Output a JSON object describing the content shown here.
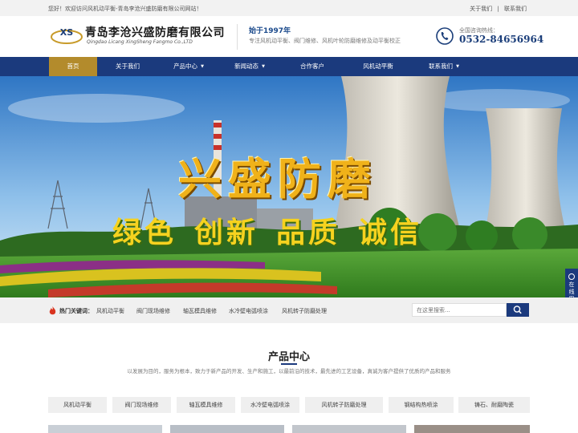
{
  "topbar": {
    "welcome": "您好！欢迎访问风机动平衡-青岛李沧兴盛防磨有限公司网站！",
    "link_about": "关于我们",
    "separator": "|",
    "link_contact": "联系我们"
  },
  "header": {
    "logo_mark": "XS",
    "logo_cn": "青岛李沧兴盛防磨有限公司",
    "logo_en": "Qingdao Licang XingSheng Fangmo Co.,LTD",
    "since": "始于1997年",
    "slogan": "专注风机动平衡、阀门维修、风机叶轮防磨维修及动平衡校正",
    "hotline_label": "全国咨询热线：",
    "hotline_number": "0532-84656964"
  },
  "nav": {
    "items": [
      {
        "label": "首页",
        "active": true,
        "dropdown": false
      },
      {
        "label": "关于我们",
        "active": false,
        "dropdown": false
      },
      {
        "label": "产品中心",
        "active": false,
        "dropdown": true
      },
      {
        "label": "新闻动态",
        "active": false,
        "dropdown": true
      },
      {
        "label": "合作客户",
        "active": false,
        "dropdown": false
      },
      {
        "label": "风机动平衡",
        "active": false,
        "dropdown": false
      },
      {
        "label": "联系我们",
        "active": false,
        "dropdown": true
      }
    ]
  },
  "banner": {
    "title": "兴盛防磨",
    "values": [
      "绿色",
      "创新",
      "品质",
      "诚信"
    ],
    "service_tab": [
      "在",
      "线",
      "客",
      "服"
    ]
  },
  "keywords": {
    "label": "热门关键词：",
    "items": [
      "风机动平衡",
      "阀门现场维修",
      "轴瓦模具维修",
      "水冷壁电弧喷涂",
      "风机转子防磨处理"
    ],
    "search_placeholder": "在这里搜索..."
  },
  "products": {
    "title": "产品中心",
    "description": "以发展为目的，服务为根本，致力于新产品的开发、生产和施工，以最前沿的技术，最先进的工艺设备，真诚为客户提供了优质的产品和服务",
    "categories": [
      "风机动平衡",
      "阀门现场维修",
      "轴瓦模具维修",
      "水冷壁电弧喷涂",
      "风机转子防磨处理",
      "钢结构热喷涂",
      "铸石、耐磨陶瓷"
    ]
  },
  "colors": {
    "nav_bg": "#1b3a7d",
    "nav_active": "#b38b2c",
    "brand_blue": "#1b3e7a"
  }
}
